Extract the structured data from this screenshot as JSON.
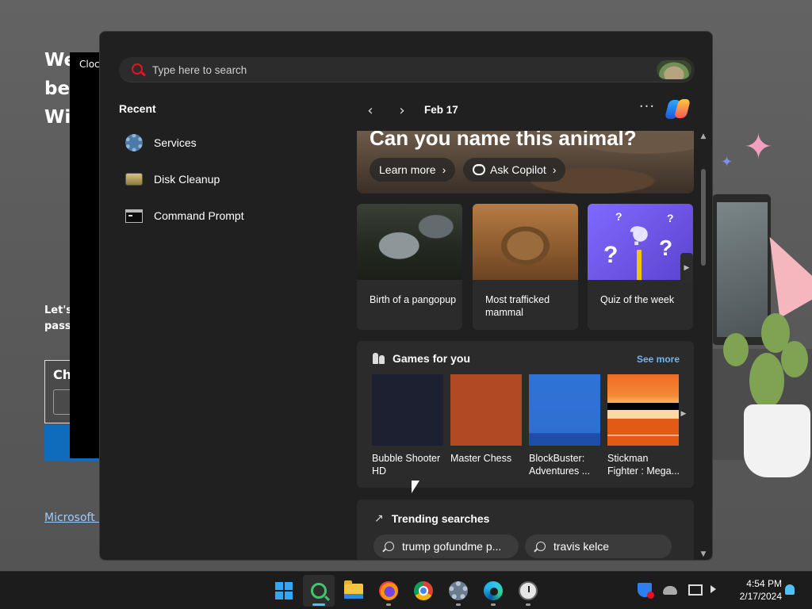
{
  "background": {
    "heading_lines": [
      "We",
      "bes",
      "Wi"
    ],
    "subtext_lines": [
      "Let's",
      "passw"
    ],
    "box_title": "Ch",
    "link_text": "Microsoft P",
    "clock_window_title": "Clock"
  },
  "start": {
    "search": {
      "placeholder": "Type here to search",
      "value": ""
    },
    "recent": {
      "title": "Recent",
      "items": [
        {
          "label": "Services",
          "icon": "services-gear-icon"
        },
        {
          "label": "Disk Cleanup",
          "icon": "disk-cleanup-icon"
        },
        {
          "label": "Command Prompt",
          "icon": "command-prompt-icon"
        }
      ]
    },
    "widgets": {
      "date": "Feb 17",
      "hero": {
        "title": "Can you name this animal?",
        "learn_more": "Learn more",
        "ask_copilot": "Ask Copilot"
      },
      "cards": [
        {
          "label": "Birth of a pangopup"
        },
        {
          "label": "Most trafficked mammal"
        },
        {
          "label": "Quiz of the week"
        }
      ],
      "games": {
        "title": "Games for you",
        "see_more": "See more",
        "items": [
          {
            "name_line1": "Bubble Shooter",
            "name_line2": "HD"
          },
          {
            "name_line1": "Master Chess",
            "name_line2": ""
          },
          {
            "name_line1": "BlockBuster:",
            "name_line2": "Adventures ..."
          },
          {
            "name_line1": "Stickman",
            "name_line2": "Fighter : Mega..."
          }
        ]
      },
      "trending": {
        "title": "Trending searches",
        "items": [
          "trump gofundme p...",
          "travis kelce"
        ]
      }
    }
  },
  "taskbar": {
    "apps": [
      "Start",
      "Search",
      "File Explorer",
      "Firefox",
      "Chrome",
      "Settings",
      "Edge",
      "Clock"
    ],
    "time": "4:54 PM",
    "date": "2/17/2024"
  },
  "colors": {
    "accent": "#4cc2ff",
    "panel_bg": "#202020",
    "card_bg": "#2b2b2b",
    "link_blue": "#6db6f5",
    "search_red": "#e81123"
  }
}
